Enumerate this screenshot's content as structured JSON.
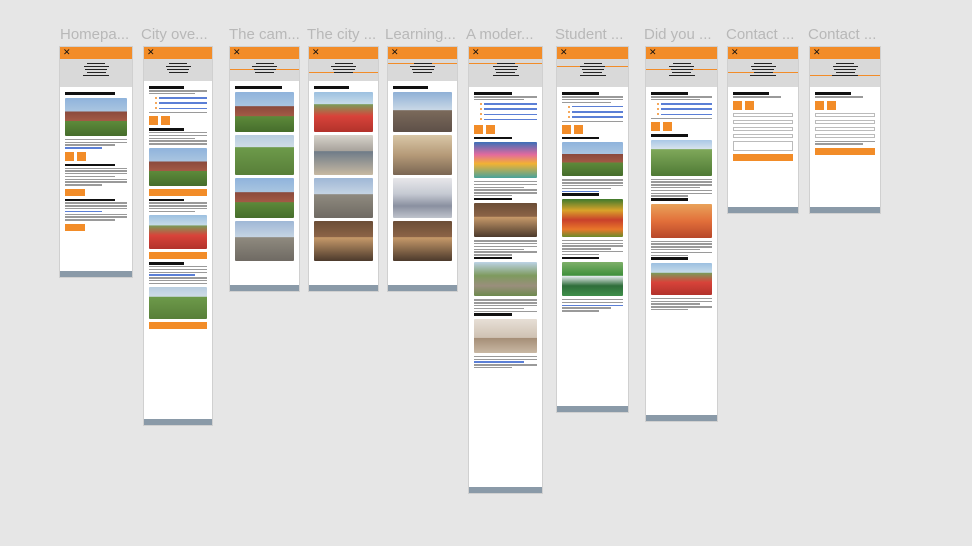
{
  "canvas": {
    "background": "#e6e6e6"
  },
  "colors": {
    "accent": "#f28c28",
    "nav": "#d9d9d9",
    "footer": "#8a9aa8",
    "frame_title": "#b8b8b8"
  },
  "frames": [
    {
      "title": "Homepa..."
    },
    {
      "title": "City ove..."
    },
    {
      "title": "The cam..."
    },
    {
      "title": "The city ..."
    },
    {
      "title": "Learning..."
    },
    {
      "title": "A moder..."
    },
    {
      "title": "Student ..."
    },
    {
      "title": "Did you ..."
    },
    {
      "title": "Contact ..."
    },
    {
      "title": "Contact ..."
    }
  ],
  "logo": {
    "icon": "crossed-logo-icon",
    "glyph": "✕"
  }
}
